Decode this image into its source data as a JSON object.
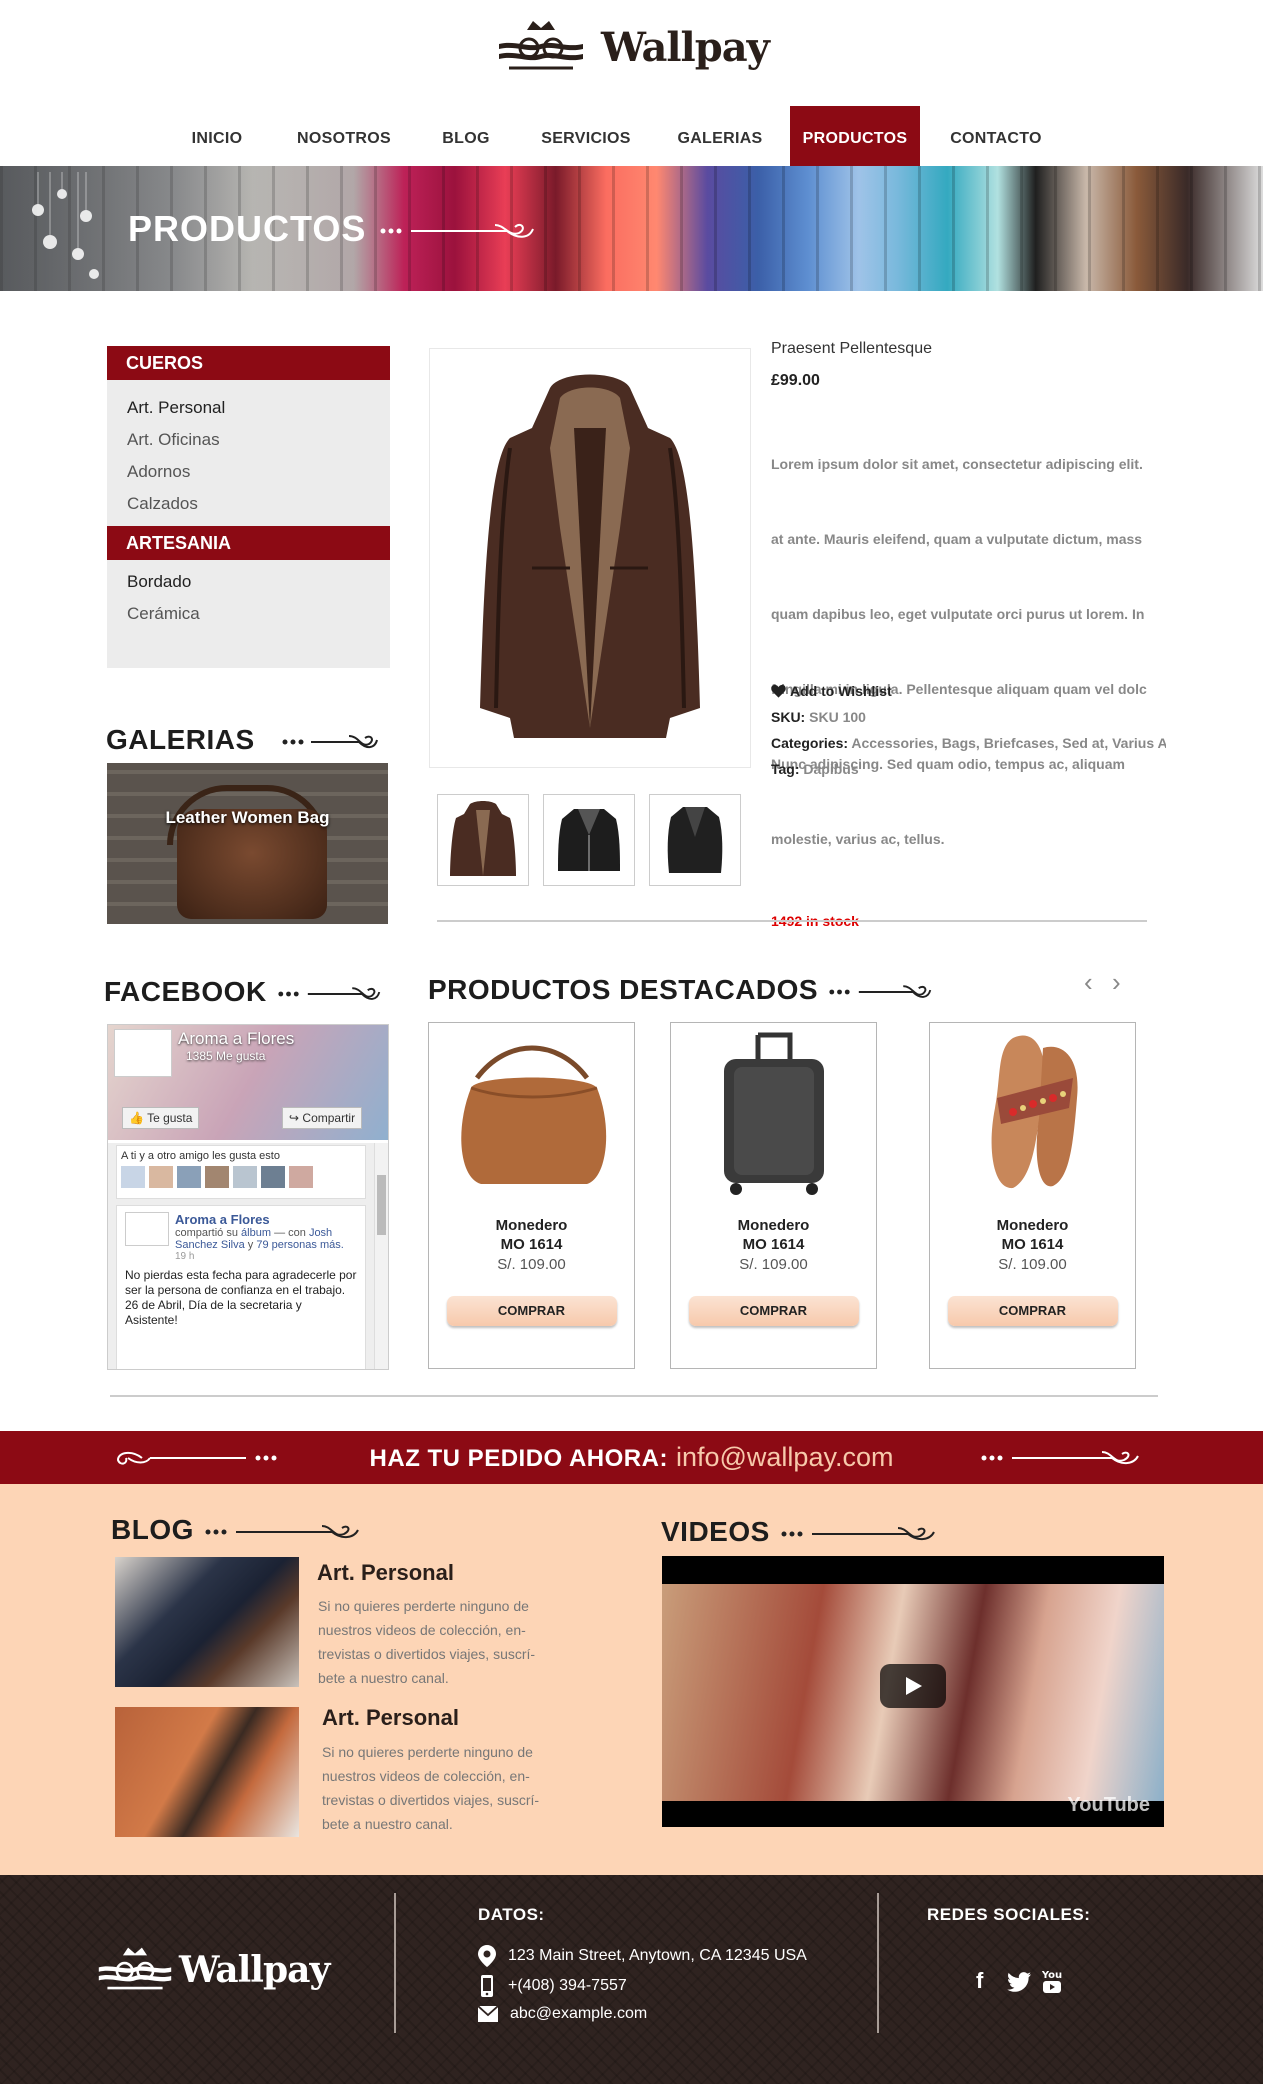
{
  "header": {
    "brand": "Wallpay",
    "nav": [
      "INICIO",
      "NOSOTROS",
      "BLOG",
      "SERVICIOS",
      "GALERIAS",
      "PRODUCTOS",
      "CONTACTO"
    ],
    "active_nav": "PRODUCTOS"
  },
  "hero": {
    "title": "PRODUCTOS"
  },
  "sidebar": {
    "cueros": {
      "title": "CUEROS",
      "items": [
        "Art. Personal",
        "Art. Oficinas",
        "Adornos",
        "Calzados"
      ]
    },
    "artesania": {
      "title": "ARTESANIA",
      "items": [
        "Bordado",
        "Cerámica"
      ]
    }
  },
  "galerias": {
    "title": "GALERIAS",
    "image_caption": "Leather Women Bag"
  },
  "product": {
    "name": "Praesent Pellentesque",
    "price": "£99.00",
    "description_lines": [
      "Lorem ipsum dolor sit amet, consectetur adipiscing elit.",
      "at ante. Mauris eleifend, quam a vulputate dictum, mass",
      "quam dapibus leo, eget vulputate orci purus ut lorem. In",
      "fringilla mi in ligula. Pellentesque aliquam quam vel dolc",
      "Nunc adipiscing. Sed quam odio, tempus ac, aliquam",
      "molestie, varius ac, tellus."
    ],
    "stock": "1492 in stock",
    "wishlist": "Add to Wishlist",
    "sku_label": "SKU:",
    "sku": "SKU 100",
    "categories_label": "Categories:",
    "categories": "Accessories, Bags, Briefcases, Sed at, Varius A",
    "tag_label": "Tag:",
    "tag": "Dapibus"
  },
  "facebook": {
    "title": "FACEBOOK",
    "page_name": "Aroma a Flores",
    "likes": "1385 Me gusta",
    "like_btn": "Te gusta",
    "share_btn": "Compartir",
    "friends_text": "A ti y a otro amigo les gusta esto",
    "post_author": "Aroma a Flores",
    "post_action": "compartió su",
    "post_album": "álbum",
    "post_with": "— con",
    "post_person": "Josh Sanchez Silva",
    "post_and": "y",
    "post_others": "79 personas más.",
    "post_time": "19 h",
    "post_message": "No pierdas esta fecha para agradecerle por ser la persona de confianza en el trabajo. 26 de Abril, Día de la secretaria y Asistente!"
  },
  "featured": {
    "title": "PRODUCTOS DESTACADOS",
    "prev_icon": "chevron-left-icon",
    "next_icon": "chevron-right-icon",
    "items": [
      {
        "name": "Monedero",
        "code": "MO 1614",
        "price": "S/. 109.00",
        "button": "COMPRAR",
        "image": "handbag"
      },
      {
        "name": "Monedero",
        "code": "MO 1614",
        "price": "S/. 109.00",
        "button": "COMPRAR",
        "image": "suitcase"
      },
      {
        "name": "Monedero",
        "code": "MO 1614",
        "price": "S/. 109.00",
        "button": "COMPRAR",
        "image": "sandal"
      }
    ]
  },
  "order": {
    "label": "HAZ TU PEDIDO AHORA:",
    "email": "info@wallpay.com"
  },
  "blog": {
    "title": "BLOG",
    "posts": [
      {
        "title": "Art. Personal",
        "text": "Si no quieres perderte ninguno de\nnuestros videos de colección, en-\ntrevistas o divertidos viajes, suscrí-\nbete a nuestro canal."
      },
      {
        "title": "Art. Personal",
        "text": "Si no quieres perderte ninguno de\nnuestros videos de colección, en-\ntrevistas o divertidos viajes, suscrí-\nbete a nuestro canal."
      }
    ]
  },
  "videos": {
    "title": "VIDEOS",
    "youtube": "YouTube"
  },
  "footer": {
    "brand": "Wallpay",
    "datos_title": "DATOS:",
    "address": "123 Main Street, Anytown, CA 12345 USA",
    "phone": "+(408) 394-7557",
    "email": "abc@example.com",
    "social_title": "REDES SOCIALES:",
    "social": [
      "facebook-icon",
      "twitter-icon",
      "youtube-icon"
    ]
  },
  "colors": {
    "brand_red": "#8c0a14",
    "peach": "#fdd5b6",
    "footer_brown": "#2f2320",
    "stock_red": "#dd0000"
  }
}
